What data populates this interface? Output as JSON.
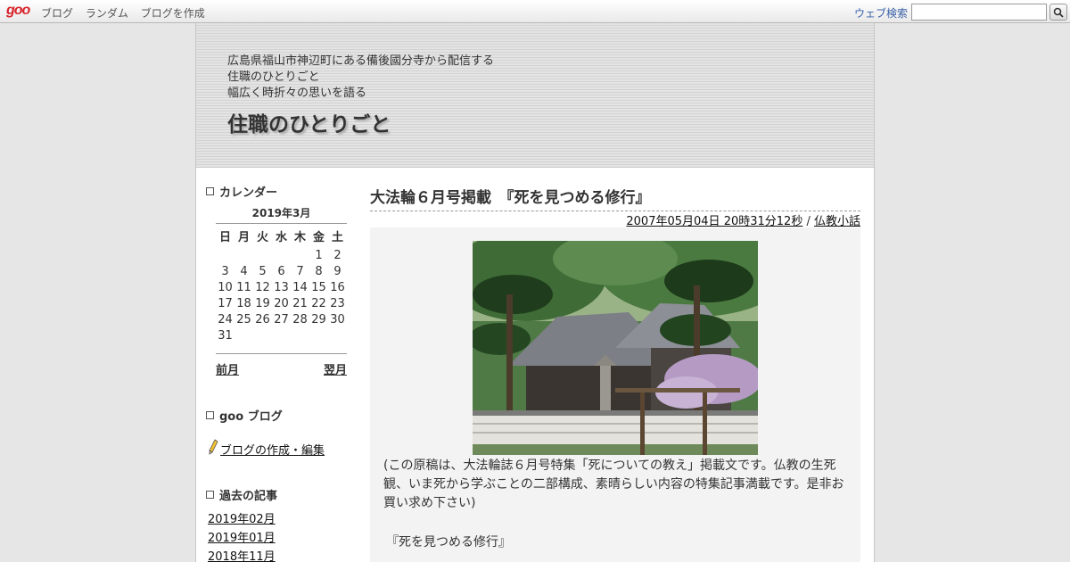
{
  "topbar": {
    "logo": "goo",
    "nav": [
      "ブログ",
      "ランダム",
      "ブログを作成"
    ],
    "search_label": "ウェブ検索",
    "search_value": "",
    "accent_color": "#d8232a",
    "link_color": "#3a62a8",
    "search_button_icon": "search-icon"
  },
  "header": {
    "description_lines": [
      "広島県福山市神辺町にある備後國分寺から配信する",
      "住職のひとりごと",
      "幅広く時折々の思いを語る"
    ],
    "blog_title": "住職のひとりごと"
  },
  "sidebar": {
    "calendar": {
      "heading": "カレンダー",
      "month": "2019年3月",
      "weekdays": [
        "日",
        "月",
        "火",
        "水",
        "木",
        "金",
        "土"
      ],
      "weeks": [
        [
          "",
          "",
          "",
          "",
          "",
          "1",
          "2"
        ],
        [
          "3",
          "4",
          "5",
          "6",
          "7",
          "8",
          "9"
        ],
        [
          "10",
          "11",
          "12",
          "13",
          "14",
          "15",
          "16"
        ],
        [
          "17",
          "18",
          "19",
          "20",
          "21",
          "22",
          "23"
        ],
        [
          "24",
          "25",
          "26",
          "27",
          "28",
          "29",
          "30"
        ],
        [
          "31",
          "",
          "",
          "",
          "",
          "",
          ""
        ]
      ],
      "prev": "前月",
      "next": "翌月"
    },
    "goo_blog": {
      "heading": "goo ブログ",
      "link": "ブログの作成・編集",
      "icon": "pencil-icon"
    },
    "archives": {
      "heading": "過去の記事",
      "items": [
        "2019年02月",
        "2019年01月",
        "2018年11月"
      ]
    }
  },
  "entry": {
    "title": "大法輪６月号掲載　『死を見つめる修行』",
    "date": "2007年05月04日 20時31分12秒",
    "separator": " / ",
    "category": "仏教小話",
    "image": "temple-photo",
    "text": "(この原稿は、大法輪誌６月号特集「死についての教え」掲載文です。仏教の生死観、いま死から学ぶことの二部構成、素晴らしい内容の特集記事満載です。是非お買い求め下さい)",
    "quote": "『死を見つめる修行』"
  }
}
